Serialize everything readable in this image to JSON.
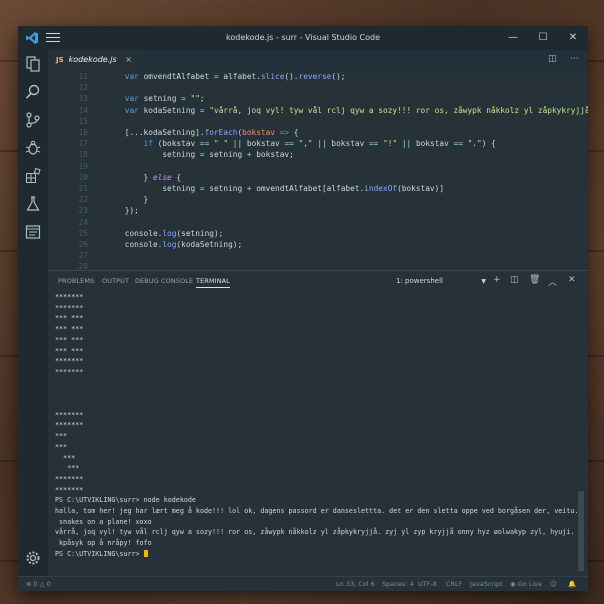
{
  "window": {
    "title": "kodekode.js - surr - Visual Studio Code",
    "accent": "#1f2a30"
  },
  "tab": {
    "file_type": "JS",
    "file_name": "kodekode.js",
    "close": "×"
  },
  "editor": {
    "line_numbers": [
      "11",
      "12",
      "13",
      "14",
      "15",
      "16",
      "17",
      "18",
      "19",
      "20",
      "21",
      "22",
      "23",
      "24",
      "25",
      "26",
      "27",
      "28"
    ],
    "lines": [
      [
        {
          "t": "    ",
          "c": ""
        },
        {
          "t": "var",
          "c": "kw"
        },
        {
          "t": " omvendtAlfabet ",
          "c": ""
        },
        {
          "t": "=",
          "c": "op"
        },
        {
          "t": " alfabet.",
          "c": ""
        },
        {
          "t": "slice",
          "c": "fn"
        },
        {
          "t": "().",
          "c": ""
        },
        {
          "t": "reverse",
          "c": "fn"
        },
        {
          "t": "();",
          "c": ""
        }
      ],
      [],
      [
        {
          "t": "    ",
          "c": ""
        },
        {
          "t": "var",
          "c": "kw"
        },
        {
          "t": " setning ",
          "c": ""
        },
        {
          "t": "=",
          "c": "op"
        },
        {
          "t": " ",
          "c": ""
        },
        {
          "t": "\"\"",
          "c": "str"
        },
        {
          "t": ";",
          "c": ""
        }
      ],
      [
        {
          "t": "    ",
          "c": ""
        },
        {
          "t": "var",
          "c": "kw"
        },
        {
          "t": " kodaSetning ",
          "c": ""
        },
        {
          "t": "=",
          "c": "op"
        },
        {
          "t": " ",
          "c": ""
        },
        {
          "t": "\"vårrå, joq vyl! tyw vål rclj qyw a sozy!!! ror os, zåwypk nåkkolz yl zåpkykryjjå. zyj yl zyp kr",
          "c": "str"
        }
      ],
      [],
      [
        {
          "t": "    [...kodaSetning].",
          "c": ""
        },
        {
          "t": "forEach",
          "c": "fn"
        },
        {
          "t": "(",
          "c": ""
        },
        {
          "t": "bokstav",
          "c": "pr"
        },
        {
          "t": " ",
          "c": ""
        },
        {
          "t": "=>",
          "c": "kw"
        },
        {
          "t": " {",
          "c": ""
        }
      ],
      [
        {
          "t": "        ",
          "c": ""
        },
        {
          "t": "if",
          "c": "kw"
        },
        {
          "t": " (bokstav ",
          "c": ""
        },
        {
          "t": "==",
          "c": "op"
        },
        {
          "t": " ",
          "c": ""
        },
        {
          "t": "\" \"",
          "c": "str"
        },
        {
          "t": " ",
          "c": ""
        },
        {
          "t": "||",
          "c": "op"
        },
        {
          "t": " bokstav ",
          "c": ""
        },
        {
          "t": "==",
          "c": "op"
        },
        {
          "t": " ",
          "c": ""
        },
        {
          "t": "\",\"",
          "c": "str"
        },
        {
          "t": " ",
          "c": ""
        },
        {
          "t": "||",
          "c": "op"
        },
        {
          "t": " bokstav ",
          "c": ""
        },
        {
          "t": "==",
          "c": "op"
        },
        {
          "t": " ",
          "c": ""
        },
        {
          "t": "\"!\"",
          "c": "str"
        },
        {
          "t": " ",
          "c": ""
        },
        {
          "t": "||",
          "c": "op"
        },
        {
          "t": " bokstav ",
          "c": ""
        },
        {
          "t": "==",
          "c": "op"
        },
        {
          "t": " ",
          "c": ""
        },
        {
          "t": "\".\"",
          "c": "str"
        },
        {
          "t": ") {",
          "c": ""
        }
      ],
      [
        {
          "t": "            setning ",
          "c": ""
        },
        {
          "t": "=",
          "c": "op"
        },
        {
          "t": " setning ",
          "c": ""
        },
        {
          "t": "+",
          "c": "op"
        },
        {
          "t": " bokstav;",
          "c": ""
        }
      ],
      [],
      [
        {
          "t": "        } ",
          "c": ""
        },
        {
          "t": "else",
          "c": "it"
        },
        {
          "t": " {",
          "c": ""
        }
      ],
      [
        {
          "t": "            setning ",
          "c": ""
        },
        {
          "t": "=",
          "c": "op"
        },
        {
          "t": " setning ",
          "c": ""
        },
        {
          "t": "+",
          "c": "op"
        },
        {
          "t": " omvendtAlfabet[alfabet.",
          "c": ""
        },
        {
          "t": "indexOf",
          "c": "fn"
        },
        {
          "t": "(bokstav)]",
          "c": ""
        }
      ],
      [
        {
          "t": "        }",
          "c": ""
        }
      ],
      [
        {
          "t": "    });",
          "c": ""
        }
      ],
      [],
      [
        {
          "t": "    console.",
          "c": ""
        },
        {
          "t": "log",
          "c": "fn"
        },
        {
          "t": "(setning);",
          "c": ""
        }
      ],
      [
        {
          "t": "    console.",
          "c": ""
        },
        {
          "t": "log",
          "c": "fn"
        },
        {
          "t": "(kodaSetning);",
          "c": ""
        }
      ],
      [],
      []
    ]
  },
  "panel": {
    "tabs": [
      "PROBLEMS",
      "OUTPUT",
      "DEBUG CONSOLE",
      "TERMINAL"
    ],
    "active_tab": "TERMINAL",
    "terminal_select": "1: powershell",
    "terminal_lines": [
      "*******",
      "*******",
      "*** ***",
      "*** ***",
      "*** ***",
      "*** ***",
      "*******",
      "*******",
      "",
      "",
      "",
      "*******",
      "*******",
      "***",
      "***",
      "  ***",
      "   ***",
      "*******",
      "*******",
      "PS C:\\UTVIKLING\\surr> node kodekode",
      "halla, tom her! jeg har lært meg å kode!!! lol ok, dagens passord er danseslettta. det er den sletta oppe ved borgåsen der, veitu.",
      " snakes on a plane! xoxo",
      "vårrå, joq vyl! tyw vål rclj qyw a sozy!!! ror os, zåwypk nåkkolz yl zåpkykryjjå. zyj yl zyp kryjjå onny hyz øolwakyp zyl, hyuji.",
      " kpåsyk op å nråpy! fofo",
      "PS C:\\UTVIKLING\\surr> "
    ]
  },
  "status": {
    "errors": "0",
    "warnings": "0",
    "position": "Ln 33, Col 6",
    "spaces": "Spaces: 4",
    "encoding": "UTF-8",
    "eol": "CRLF",
    "language": "JavaScript",
    "golive": "Go Live"
  }
}
